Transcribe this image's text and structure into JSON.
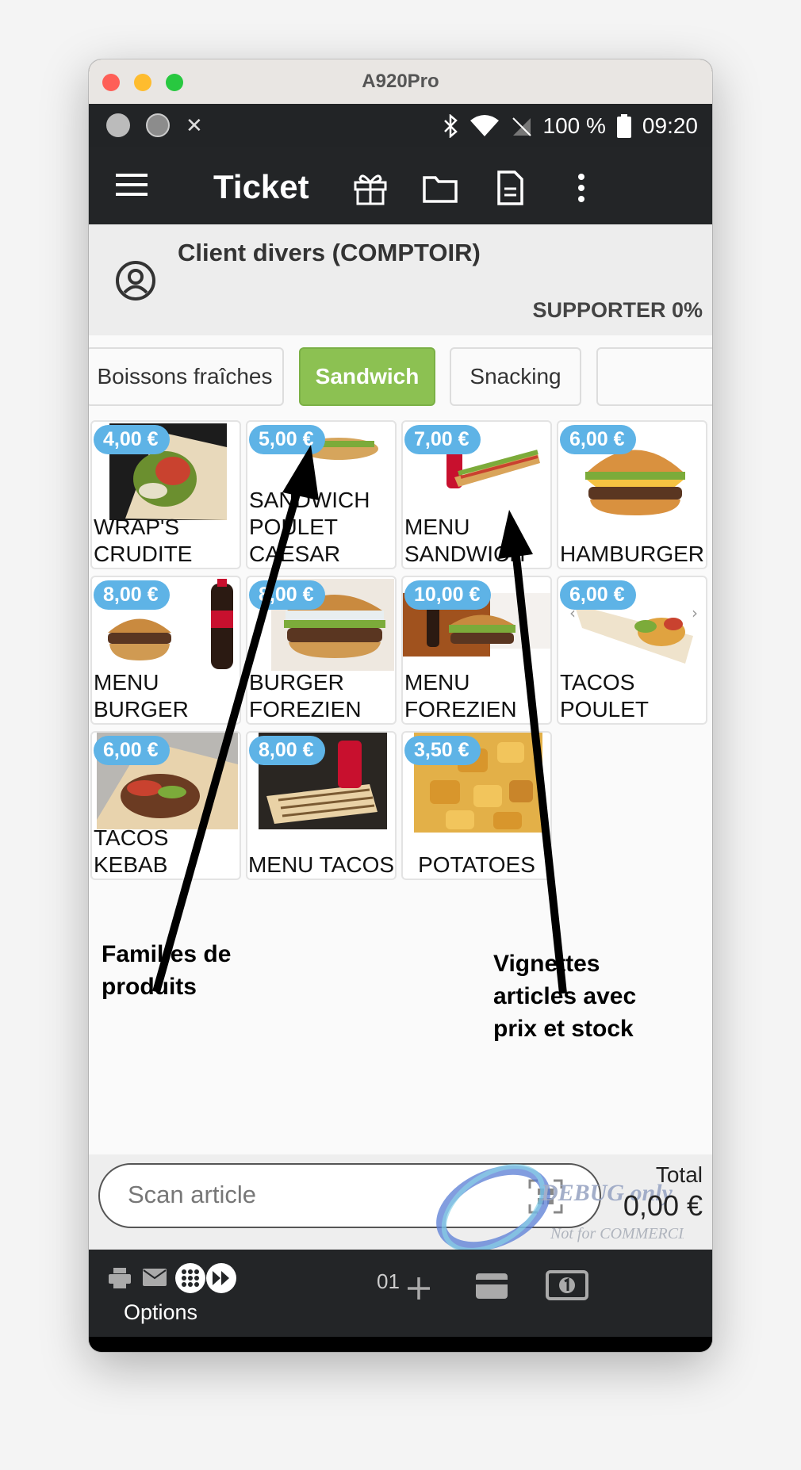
{
  "window": {
    "title": "A920Pro"
  },
  "status_bar": {
    "battery": "100 %",
    "time": "09:20"
  },
  "app_bar": {
    "title": "Ticket"
  },
  "client": {
    "name": "Client divers (COMPTOIR)",
    "discount": "SUPPORTER 0%"
  },
  "categories": [
    {
      "label": "Boissons fraîches",
      "active": false
    },
    {
      "label": "Sandwich",
      "active": true
    },
    {
      "label": "Snacking",
      "active": false
    }
  ],
  "products": [
    {
      "price": "4,00 €",
      "name_lines": [
        "WRAP'S",
        "CRUDITE"
      ]
    },
    {
      "price": "5,00 €",
      "name_lines": [
        "SANDWICH",
        "POULET",
        "CAESAR"
      ]
    },
    {
      "price": "7,00 €",
      "name_lines": [
        "MENU",
        "SANDWICH"
      ]
    },
    {
      "price": "6,00 €",
      "name_lines": [
        "HAMBURGER"
      ]
    },
    {
      "price": "8,00 €",
      "name_lines": [
        "MENU",
        "BURGER"
      ]
    },
    {
      "price": "8,00 €",
      "name_lines": [
        "BURGER",
        "FOREZIEN"
      ]
    },
    {
      "price": "10,00 €",
      "name_lines": [
        "MENU",
        "FOREZIEN"
      ]
    },
    {
      "price": "6,00 €",
      "name_lines": [
        "TACOS",
        "POULET"
      ]
    },
    {
      "price": "6,00 €",
      "name_lines": [
        "TACOS",
        "KEBAB"
      ]
    },
    {
      "price": "8,00 €",
      "name_lines": [
        "MENU TACOS"
      ]
    },
    {
      "price": "3,50 €",
      "name_lines": [
        "POTATOES"
      ]
    }
  ],
  "annotations": {
    "left_line1": "Familles de",
    "left_line2": "produits",
    "right_line1": "Vignettes",
    "right_line2": "articles avec",
    "right_line3": "prix et stock"
  },
  "scan": {
    "placeholder": "Scan article"
  },
  "total": {
    "label": "Total",
    "value": "0,00 €"
  },
  "watermark": {
    "line1": "DEBUG only",
    "line2": "Not for COMMERCIAL"
  },
  "action_bar": {
    "options_label": "Options",
    "quantity": "01"
  },
  "colors": {
    "accent_green": "#8cc152",
    "price_blue": "#5eb3e6",
    "bar_dark": "#232527"
  },
  "icons": [
    "menu-icon",
    "gift-icon",
    "folder-icon",
    "document-icon",
    "more-vert-icon",
    "account-icon",
    "qr-scan-icon",
    "print-icon",
    "mail-icon",
    "keypad-icon",
    "fast-forward-icon",
    "plus-icon",
    "card-icon",
    "cash-icon",
    "recent-apps-icon",
    "home-icon",
    "back-icon",
    "bluetooth-icon",
    "wifi-icon",
    "no-signal-icon",
    "battery-icon"
  ]
}
